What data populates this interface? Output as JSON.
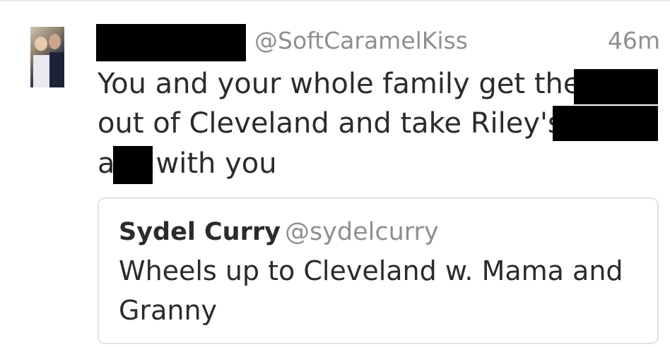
{
  "tweet": {
    "handle": "@SoftCaramelKiss",
    "time": "46m",
    "line1": "You and your whole family get the f",
    "line2": "out of Cleveland and take Riley's f",
    "line3_a": "a",
    "line3_b": "with you"
  },
  "quoted_tweet": {
    "name": "Sydel Curry",
    "handle": "@sydelcurry",
    "text": "Wheels up to Cleveland w. Mama and Granny"
  },
  "colors": {
    "text": "#2b2b2b",
    "muted": "#8f8f8f",
    "redaction": "#000000",
    "border": "#e3e3e3"
  }
}
